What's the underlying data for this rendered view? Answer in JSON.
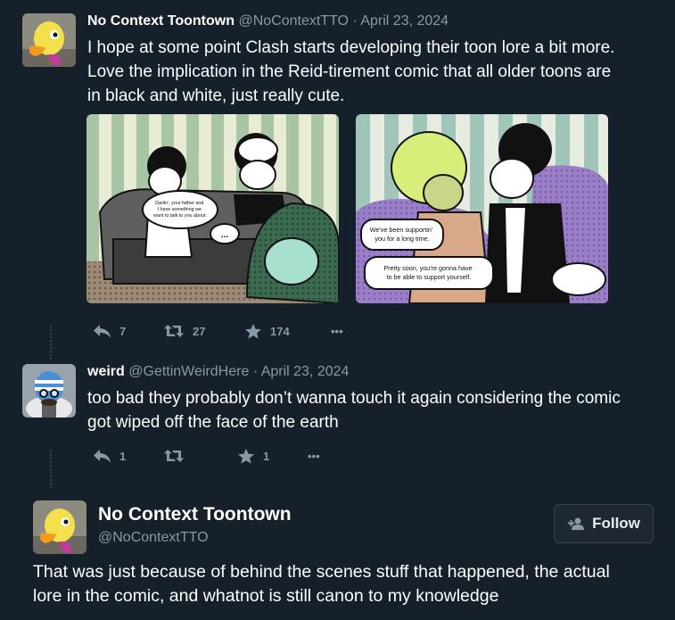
{
  "tweets": [
    {
      "name": "No Context Toontown",
      "handle": "@NoContextTTO",
      "date": "· April 23, 2024",
      "text": "I hope at some point Clash starts developing their toon lore a bit more. Love the implication in the Reid-tirement comic that all older toons are in black and white, just really cute.",
      "media": [
        {
          "bubble": "Darlin', your father and I have something we want to talk to you about.",
          "dots": "..."
        },
        {
          "bubble1": "We've been supportin' you for a long time.",
          "bubble2": "Pretty soon, you're gonna have to be able to support yourself."
        }
      ],
      "replies": "7",
      "retweets": "27",
      "likes": "174",
      "more": "•••"
    },
    {
      "name": "weird",
      "handle": "@GettinWeirdHere",
      "date": "· April 23, 2024",
      "text": "too bad they probably don’t wanna touch it again considering the comic got wiped off the face of the earth",
      "replies": "1",
      "retweets": "",
      "likes": "1",
      "more": "•••"
    }
  ],
  "main_tweet": {
    "name": "No Context Toontown",
    "handle": "@NoContextTTO",
    "follow_label": "Follow",
    "text": "That was just because of behind the scenes stuff that happened, the actual lore in the comic, and whatnot is still canon to my knowledge"
  },
  "icons": [
    "reply-icon",
    "retweet-icon",
    "like-icon",
    "more-icon",
    "follow-person-icon"
  ]
}
